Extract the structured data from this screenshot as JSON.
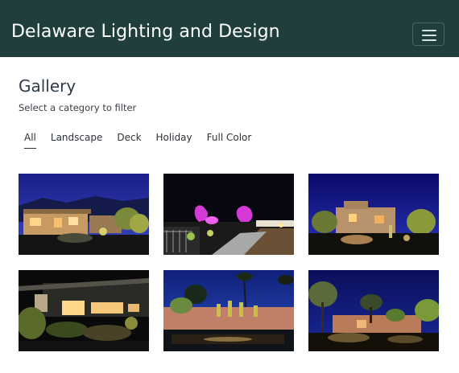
{
  "navbar": {
    "brand": "Delaware Lighting and Design",
    "toggle_icon": "hamburger-menu-icon"
  },
  "gallery": {
    "title": "Gallery",
    "subtitle": "Select a category to filter",
    "filters": [
      {
        "label": "All",
        "active": true
      },
      {
        "label": "Landscape",
        "active": false
      },
      {
        "label": "Deck",
        "active": false
      },
      {
        "label": "Holiday",
        "active": false
      },
      {
        "label": "Full Color",
        "active": false
      }
    ],
    "photos": [
      {
        "subject": "house-night-landscape-lighting-1"
      },
      {
        "subject": "patio-purple-accent-lighting"
      },
      {
        "subject": "desert-house-landscape-lighting"
      },
      {
        "subject": "modern-house-porch-lighting"
      },
      {
        "subject": "pool-palm-tree-lighting"
      },
      {
        "subject": "desert-trees-house-lighting"
      }
    ]
  },
  "colors": {
    "navbar_bg": "#1f3e3c",
    "text": "#2f3b4a"
  }
}
